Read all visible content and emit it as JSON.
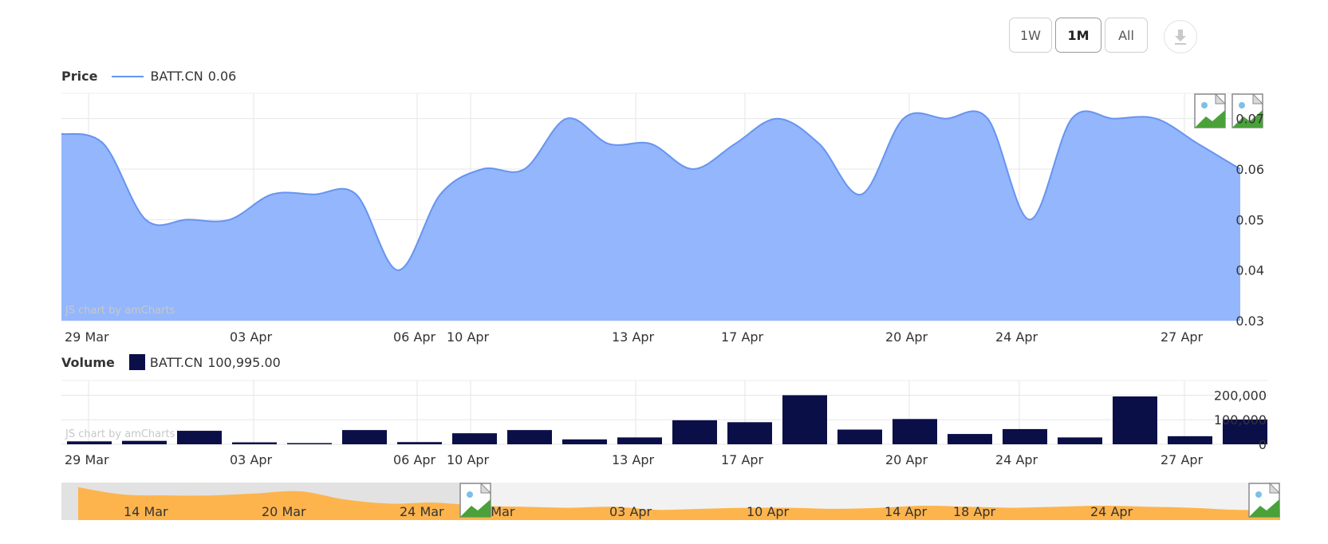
{
  "toolbar": {
    "buttons": [
      {
        "label": "1W",
        "active": false
      },
      {
        "label": "1M",
        "active": true
      },
      {
        "label": "All",
        "active": false
      }
    ],
    "download_icon": "download-icon"
  },
  "price_panel": {
    "title": "Price",
    "series_label": "BATT.CN",
    "series_value": "0.06",
    "credit": "JS chart by amCharts"
  },
  "volume_panel": {
    "title": "Volume",
    "series_label": "BATT.CN",
    "series_value": "100,995.00",
    "credit": "JS chart by amCharts"
  },
  "chart_data": [
    {
      "type": "area",
      "title": "Price",
      "series": [
        {
          "name": "BATT.CN",
          "values": [
            0.067,
            0.065,
            0.05,
            0.05,
            0.05,
            0.055,
            0.055,
            0.055,
            0.04,
            0.055,
            0.06,
            0.06,
            0.07,
            0.065,
            0.065,
            0.06,
            0.065,
            0.07,
            0.065,
            0.055,
            0.07,
            0.07,
            0.07,
            0.05,
            0.07,
            0.07,
            0.07,
            0.065,
            0.06
          ]
        }
      ],
      "ylim": [
        0.03,
        0.075
      ],
      "yticks": [
        "0.03",
        "0.04",
        "0.05",
        "0.06",
        "0.07"
      ],
      "xticks": [
        "29 Mar",
        "03 Apr",
        "06 Apr",
        "10 Apr",
        "13 Apr",
        "17 Apr",
        "20 Apr",
        "24 Apr",
        "27 Apr"
      ],
      "color": "#6794f0",
      "fill": "#93b6fd",
      "grid": true
    },
    {
      "type": "bar",
      "title": "Volume",
      "series": [
        {
          "name": "BATT.CN",
          "values": [
            12000,
            14000,
            55000,
            8000,
            5000,
            58000,
            9000,
            45000,
            58000,
            20000,
            28000,
            98000,
            90000,
            200000,
            60000,
            103000,
            42000,
            62000,
            28000,
            195000,
            33000,
            100995
          ]
        }
      ],
      "ylim": [
        0,
        260000
      ],
      "yticks": [
        "0",
        "100,000",
        "200,000"
      ],
      "xticks": [
        "29 Mar",
        "03 Apr",
        "06 Apr",
        "10 Apr",
        "13 Apr",
        "17 Apr",
        "20 Apr",
        "24 Apr",
        "27 Apr"
      ],
      "color": "#0a0f47",
      "grid": true
    },
    {
      "type": "area",
      "title": "",
      "series": [
        {
          "name": "",
          "values": [
            0.072,
            0.065,
            0.064,
            0.064,
            0.066,
            0.068,
            0.06,
            0.056,
            0.057,
            0.054,
            0.053,
            0.052,
            0.053,
            0.05,
            0.051,
            0.052,
            0.052,
            0.051,
            0.052,
            0.054,
            0.053,
            0.052,
            0.053,
            0.054,
            0.053,
            0.052,
            0.05,
            0.05
          ]
        }
      ],
      "xticks": [
        "14 Mar",
        "20 Mar",
        "24 Mar",
        "3 Mar",
        "03 Apr",
        "10 Apr",
        "14 Apr",
        "18 Apr",
        "24 Apr"
      ],
      "color": "#fdb44d",
      "fill": "#fdb44d"
    }
  ]
}
